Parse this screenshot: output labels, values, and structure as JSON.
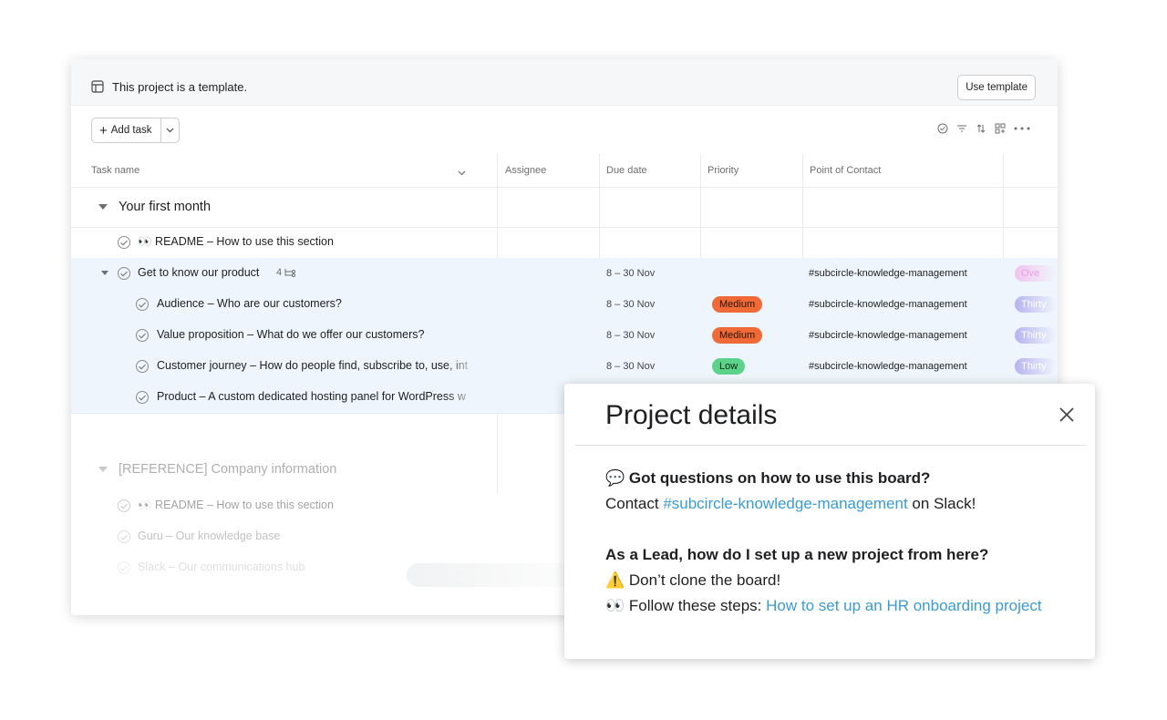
{
  "banner": {
    "text": "This project is a template.",
    "use_template": "Use template"
  },
  "toolbar": {
    "add_task": "Add task"
  },
  "columns": [
    "Task name",
    "Assignee",
    "Due date",
    "Priority",
    "Point of Contact"
  ],
  "sections": [
    {
      "title": "Your first month"
    },
    {
      "title": "[REFERENCE] Company information"
    }
  ],
  "tasks": [
    {
      "name": "👀 README – How to use this section",
      "due": "",
      "priority": "",
      "poc": ""
    },
    {
      "name": "Get to know our product",
      "subtasks": "4",
      "due": "8 – 30 Nov",
      "priority": "",
      "poc": "#subcircle-knowledge-management",
      "tag": "Ove"
    },
    {
      "name": "Audience – Who are our customers?",
      "due": "8 – 30 Nov",
      "priority": "Medium",
      "poc": "#subcircle-knowledge-management",
      "tag": "Thirty"
    },
    {
      "name": "Value proposition – What do we offer our customers?",
      "due": "8 – 30 Nov",
      "priority": "Medium",
      "poc": "#subcircle-knowledge-management",
      "tag": "Thirty"
    },
    {
      "name": "Customer journey – How do people find, subscribe to, use, int",
      "due": "8 – 30 Nov",
      "priority": "Low",
      "poc": "#subcircle-knowledge-management",
      "tag": "Thirty"
    },
    {
      "name": "Product – A custom dedicated hosting panel for WordPress w",
      "due": "",
      "priority": "",
      "poc": ""
    }
  ],
  "reference_tasks": [
    {
      "name": "👀 README – How to use this section"
    },
    {
      "name": "Guru – Our knowledge base"
    },
    {
      "name": "Slack – Our communications hub"
    }
  ],
  "modal": {
    "title": "Project details",
    "q1": "💬 Got questions on how to use this board?",
    "contact_prefix": "Contact ",
    "contact_link": "#subcircle-knowledge-management",
    "contact_suffix": " on Slack!",
    "q2": "As a Lead, how do I set up a new project from here?",
    "warn": "⚠️ Don’t clone the board!",
    "steps_prefix": "👀 Follow these steps: ",
    "steps_link": "How to set up an HR onboarding project"
  },
  "colors": {
    "medium": "#f06a37",
    "low": "#5cd38a",
    "link": "#3a9bd3",
    "highlight": "#eef5fc"
  }
}
